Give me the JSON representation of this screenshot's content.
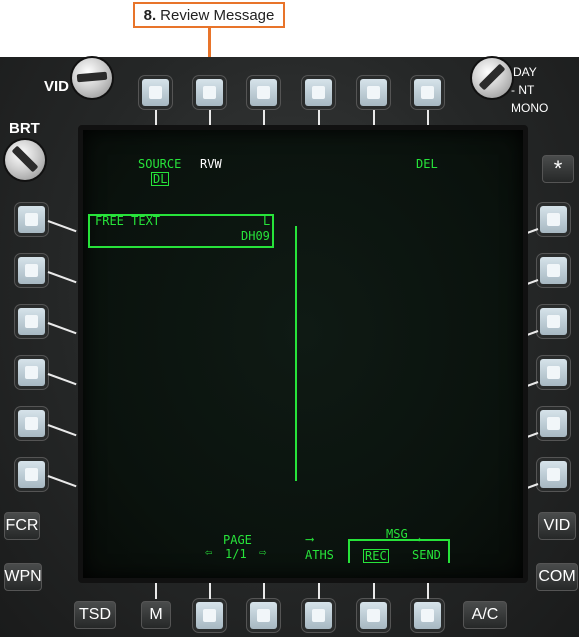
{
  "callout": {
    "number": "8.",
    "label": "Review Message"
  },
  "panel": {
    "vid_knob": "VID",
    "brt_knob": "BRT",
    "mode_knob": {
      "day": "DAY",
      "nt": "- NT",
      "mono": "MONO"
    },
    "star_button": "*"
  },
  "left_buttons": [
    "FCR",
    "WPN",
    "TSD"
  ],
  "right_buttons": [
    "VID",
    "COM",
    "A/C"
  ],
  "bottom_m_button": "M",
  "display": {
    "source_label": "SOURCE",
    "source_value": "DL",
    "rvw_label": "RVW",
    "del_label": "DEL",
    "message": {
      "title": "FREE TEXT",
      "flag": "L",
      "id": "DH09"
    },
    "page_label": "PAGE",
    "page_value": "1/1",
    "aths_label": "ATHS",
    "msg_label": "MSG",
    "rec_label": "REC",
    "send_label": "SEND"
  },
  "colors": {
    "symbology": "#27e33a",
    "callout_border": "#e8742a"
  }
}
